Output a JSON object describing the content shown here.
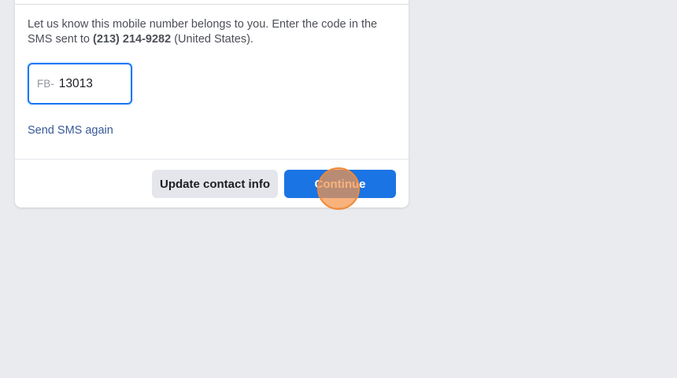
{
  "verification": {
    "instructions_prefix": "Let us know this mobile number belongs to you. Enter the code in the SMS sent to ",
    "phone_number": "(213) 214-9282",
    "instructions_suffix": " (United States).",
    "code_prefix": "FB-",
    "code_value": "13013",
    "resend_link": "Send SMS again"
  },
  "footer": {
    "update_contact_label": "Update contact info",
    "continue_label": "Continue"
  },
  "colors": {
    "primary": "#1b74e4",
    "link": "#385898",
    "page_background": "#e9ebee",
    "click_marker": "#f08a38"
  }
}
